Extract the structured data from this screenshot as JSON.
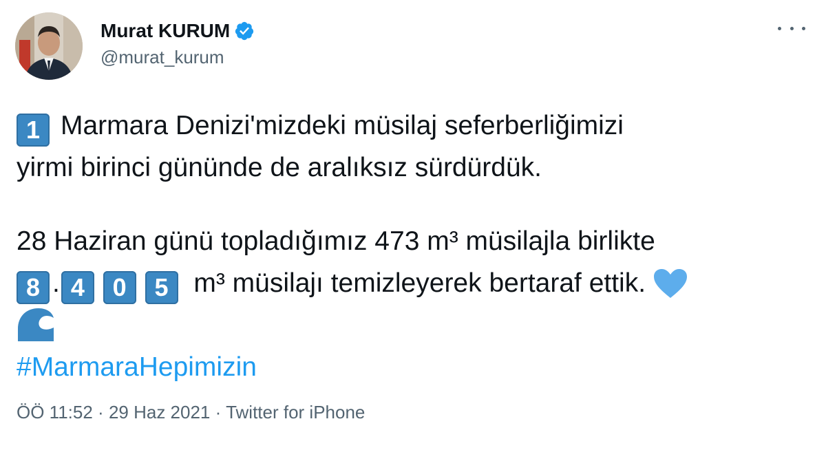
{
  "author": {
    "name": "Murat KURUM",
    "handle": "@murat_kurum",
    "verified": true
  },
  "tweet": {
    "line1_keycap": "1",
    "line1_text": "Marmara Denizi'mizdeki müsilaj seferberliğimizi",
    "line2_text": "yirmi birinci gününde de aralıksız sürdürdük.",
    "line3_text": "28 Haziran günü topladığımız 473 m³ müsilajla birlikte",
    "line4_keycaps": [
      "8",
      "4",
      "0",
      "5"
    ],
    "line4_separator": ".",
    "line4_text": "m³ müsilajı temizleyerek bertaraf ettik.",
    "emojis": [
      "blue-heart-icon",
      "water-wave-icon"
    ],
    "hashtag": "#MarmaraHepimizin"
  },
  "meta": {
    "time": "ÖÖ 11:52",
    "separator": "·",
    "date": "29 Haz 2021",
    "source": "Twitter for iPhone"
  },
  "colors": {
    "keycap": "#3b88c3",
    "hashtag": "#1d9bf0",
    "verified": "#1d9bf0",
    "heart": "#5dadec",
    "secondary_text": "#536471"
  }
}
